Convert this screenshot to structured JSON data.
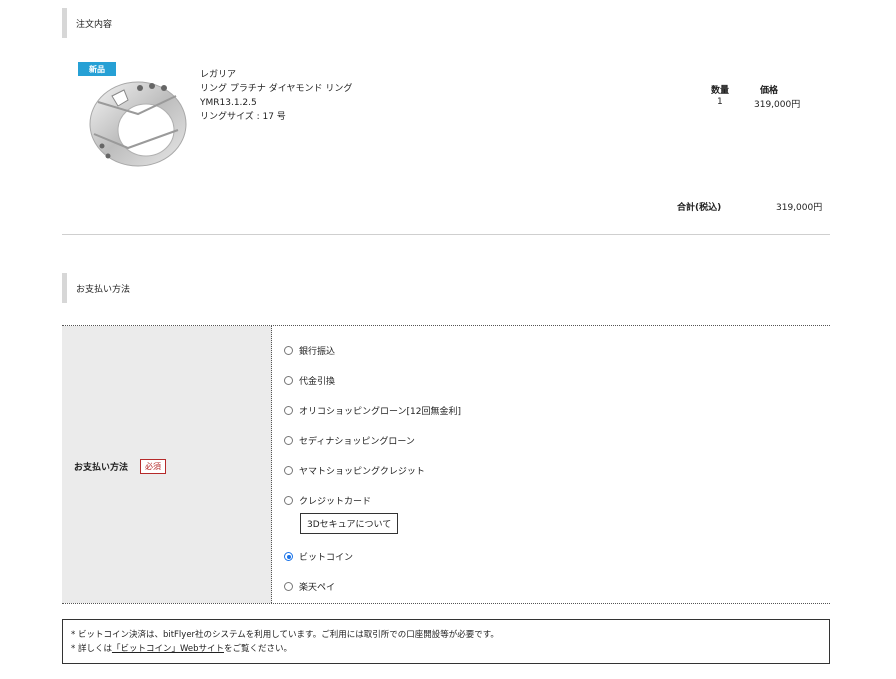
{
  "order": {
    "heading": "注文内容",
    "badge": "新品",
    "brand": "レガリア",
    "name": "リング プラチナ ダイヤモンド リング",
    "code": "YMR13.1.2.5",
    "size": "リングサイズ : 17 号",
    "qty_label": "数量",
    "price_label": "価格",
    "qty": "1",
    "price": "319,000円",
    "total_label": "合計(税込)",
    "total": "319,000円"
  },
  "payment": {
    "heading": "お支払い方法",
    "label": "お支払い方法",
    "required": "必須",
    "options": [
      {
        "label": "銀行振込",
        "checked": false
      },
      {
        "label": "代金引換",
        "checked": false
      },
      {
        "label": "オリコショッピングローン[12回無金利]",
        "checked": false
      },
      {
        "label": "セディナショッピングローン",
        "checked": false
      },
      {
        "label": "ヤマトショッピングクレジット",
        "checked": false
      },
      {
        "label": "クレジットカード",
        "checked": false
      },
      {
        "label": "ビットコイン",
        "checked": true
      },
      {
        "label": "楽天ペイ",
        "checked": false
      }
    ],
    "secure_button": "3Dセキュアについて"
  },
  "note": {
    "line1": "* ビットコイン決済は、bitFlyer社のシステムを利用しています。ご利用には取引所での口座開設等が必要です。",
    "line2_prefix": "* 詳しくは",
    "line2_link": "「ビットコイン」Webサイト",
    "line2_suffix": "をご覧ください。"
  },
  "colors": {
    "badge": "#26a0d5",
    "required": "#b52a2a",
    "radio_checked": "#1a73e8",
    "label_cell": "#ebebeb"
  }
}
